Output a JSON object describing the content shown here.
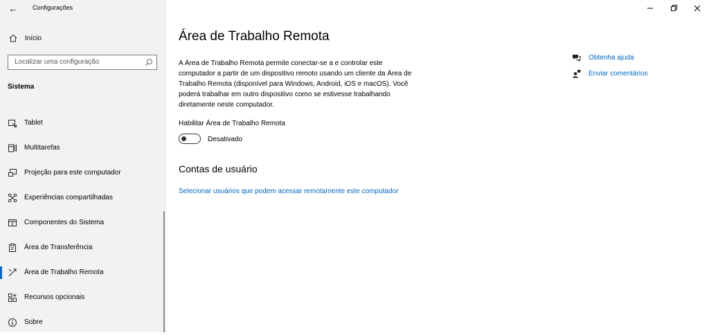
{
  "window": {
    "title": "Configurações",
    "controls": [
      "minimize-icon",
      "restore-icon",
      "close-icon"
    ]
  },
  "sidebar": {
    "home_label": "Início",
    "search_placeholder": "Localizar uma configuração",
    "section_title": "Sistema",
    "items": [
      {
        "label": "Tablet",
        "icon": "tablet-icon"
      },
      {
        "label": "Multitarefas",
        "icon": "multitasking-icon"
      },
      {
        "label": "Projeção para este computador",
        "icon": "projection-icon"
      },
      {
        "label": "Experiências compartilhadas",
        "icon": "shared-experiences-icon"
      },
      {
        "label": "Componentes do Sistema",
        "icon": "system-components-icon"
      },
      {
        "label": "Área de Transferência",
        "icon": "clipboard-icon"
      },
      {
        "label": "Área de Trabalho Remota",
        "icon": "remote-desktop-icon",
        "selected": true
      },
      {
        "label": "Recursos opcionais",
        "icon": "optional-features-icon"
      },
      {
        "label": "Sobre",
        "icon": "info-icon"
      }
    ]
  },
  "main": {
    "title": "Área de Trabalho Remota",
    "description": "A Área de Trabalho Remota permite conectar-se a e controlar este computador a partir de um dispositivo remoto usando um cliente da Área de Trabalho Remota (disponível para Windows, Android, iOS e macOS). Você poderá trabalhar em outro dispositivo como se estivesse trabalhando diretamente neste computador.",
    "toggle_label": "Habilitar Área de Trabalho Remota",
    "toggle_state": "Desativado",
    "toggle_on": false,
    "users_section_title": "Contas de usuário",
    "users_link": "Selecionar usuários que podem acessar remotamente este computador"
  },
  "help": {
    "get_help": "Obtenha ajuda",
    "feedback": "Enviar comentários"
  },
  "colors": {
    "accent": "#0067c0",
    "sidebar_bg": "#f2f2f2"
  }
}
